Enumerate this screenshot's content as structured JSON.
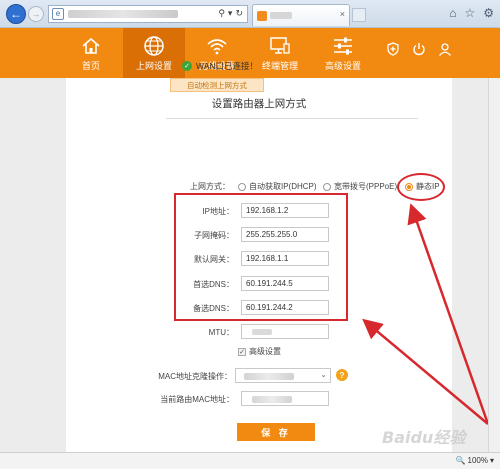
{
  "browser": {
    "back_icon": "arrow-left-icon",
    "forward_icon": "arrow-right-icon",
    "tab_close": "×",
    "window_icons": [
      "home-icon",
      "star-icon",
      "gear-icon"
    ]
  },
  "nav": {
    "items": [
      {
        "label": "首页",
        "icon": "home-icon"
      },
      {
        "label": "上网设置",
        "icon": "globe-icon"
      },
      {
        "label": "无线设置",
        "icon": "wifi-icon"
      },
      {
        "label": "终端管理",
        "icon": "monitor-icon"
      },
      {
        "label": "高级设置",
        "icon": "sliders-icon"
      }
    ],
    "active_index": 1,
    "accent": "#f28a12",
    "active_bg": "#d96f05"
  },
  "page": {
    "title": "设置路由器上网方式",
    "wan_status": "WAN口已连接！",
    "auto_detect": "自动检测上网方式"
  },
  "connection": {
    "label": "上网方式：",
    "options": [
      "自动获取IP(DHCP)",
      "宽带拨号(PPPoE)",
      "静态IP"
    ],
    "selected": "静态IP"
  },
  "static": {
    "ip_label": "IP地址：",
    "ip_value": "192.168.1.2",
    "mask_label": "子网掩码：",
    "mask_value": "255.255.255.0",
    "gateway_label": "默认网关：",
    "gateway_value": "192.168.1.1",
    "dns1_label": "首选DNS：",
    "dns1_value": "60.191.244.5",
    "dns2_label": "备选DNS：",
    "dns2_value": "60.191.244.2",
    "mtu_label": "MTU："
  },
  "advanced": {
    "checkbox_label": "高级设置",
    "mac_clone_label": "MAC地址克隆操作：",
    "help": "?",
    "current_mac_label": "当前路由MAC地址："
  },
  "actions": {
    "save": "保 存"
  },
  "status_bar": {
    "zoom": "100%"
  },
  "watermark": "Baidu经验",
  "annotation_color": "#d7282e"
}
